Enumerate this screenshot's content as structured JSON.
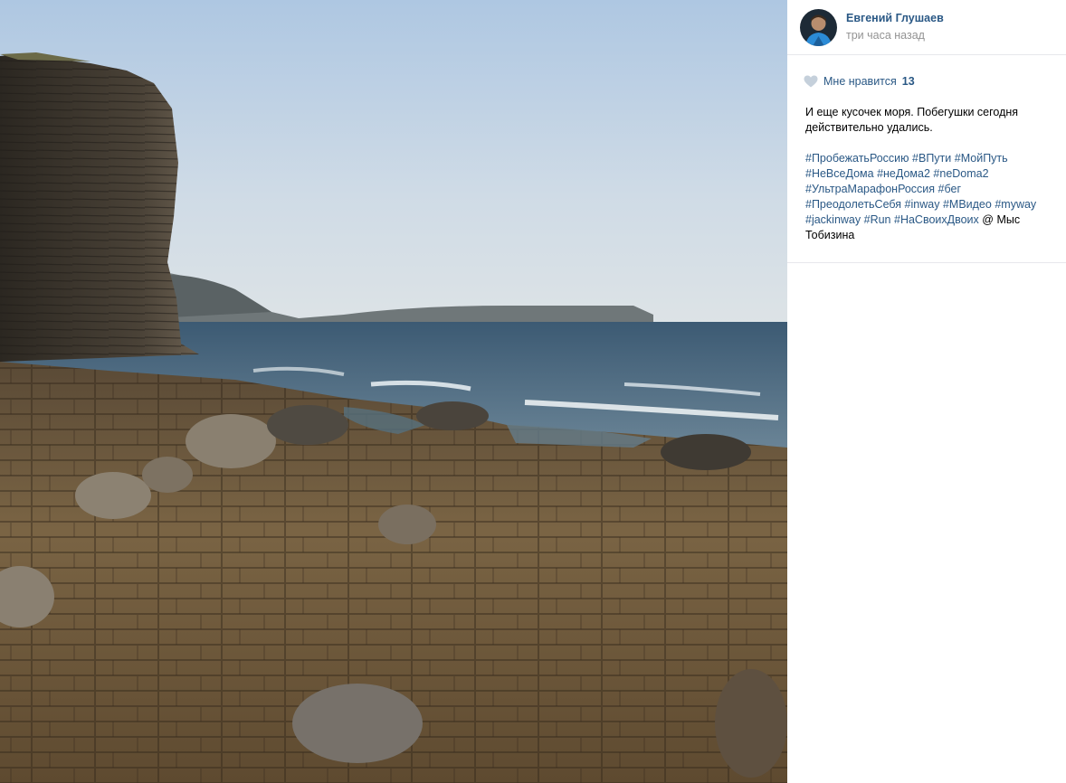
{
  "post": {
    "author": "Евгений Глушаев",
    "time": "три часа назад",
    "likes_label": "Мне нравится",
    "likes_count": "13",
    "caption": "И еще кусочек моря. Побегушки сегодня действительно удались.",
    "hashtags": [
      "#ПробежатьРоссию",
      "#ВПути",
      "#МойПуть",
      "#НеВсеДома",
      "#неДома2",
      "#neDoma2",
      "#УльтраМарафонРоссия",
      "#бег",
      "#ПреодолетьСебя",
      "#inway",
      "#МВидео",
      "#myway",
      "#jackinway",
      "#Run",
      "#НаСвоихДвоих"
    ],
    "location_prefix": "@ ",
    "location": "Мыс Тобизина"
  },
  "icons": {
    "like": "heart-icon",
    "avatar": "avatar"
  },
  "colors": {
    "link": "#2a5885",
    "muted": "#939393",
    "divider": "#e7e8ec"
  }
}
